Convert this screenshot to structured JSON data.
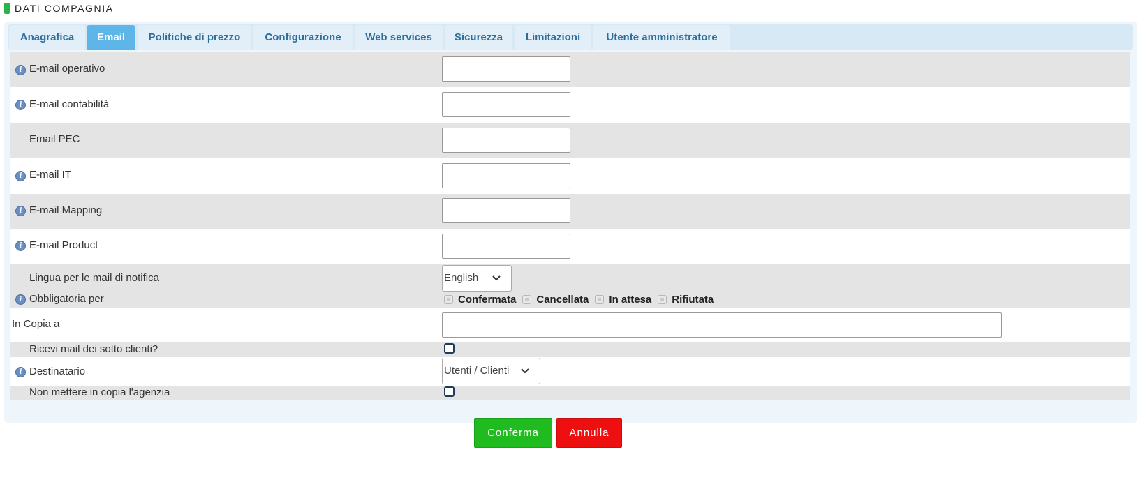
{
  "page": {
    "title": "DATI COMPAGNIA"
  },
  "tabs": [
    {
      "label": "Anagrafica",
      "active": false
    },
    {
      "label": "Email",
      "active": true
    },
    {
      "label": "Politiche di prezzo",
      "active": false
    },
    {
      "label": "Configurazione",
      "active": false
    },
    {
      "label": "Web services",
      "active": false
    },
    {
      "label": "Sicurezza",
      "active": false
    },
    {
      "label": "Limitazioni",
      "active": false
    },
    {
      "label": "Utente amministratore",
      "active": false
    }
  ],
  "form": {
    "email_operativo": {
      "label": "E-mail operativo",
      "value": "",
      "has_info": true
    },
    "email_contabilita": {
      "label": "E-mail contabilità",
      "value": "",
      "has_info": true
    },
    "email_pec": {
      "label": "Email PEC",
      "value": "",
      "has_info": false
    },
    "email_it": {
      "label": "E-mail IT",
      "value": "",
      "has_info": true
    },
    "email_mapping": {
      "label": "E-mail Mapping",
      "value": "",
      "has_info": true
    },
    "email_product": {
      "label": "E-mail Product",
      "value": "",
      "has_info": true
    },
    "lingua": {
      "label": "Lingua per le mail di notifica",
      "selected": "English"
    },
    "obbligatoria": {
      "label": "Obbligatoria per",
      "options": [
        "Confermata",
        "Cancellata",
        "In attesa",
        "Rifiutata"
      ]
    },
    "in_copia": {
      "label": "In Copia a",
      "value": ""
    },
    "ricevi_sotto_clienti": {
      "label": "Ricevi mail dei sotto clienti?",
      "checked": false
    },
    "destinatario": {
      "label": "Destinatario",
      "selected": "Utenti / Clienti"
    },
    "non_copia_agenzia": {
      "label": "Non mettere in copia l'agenzia",
      "checked": false
    }
  },
  "actions": {
    "confirm_label": "Conferma",
    "cancel_label": "Annulla"
  },
  "colors": {
    "tab_active": "#5db5e8",
    "tab_text": "#2c6f9b",
    "confirm": "#1fbb1f",
    "cancel": "#ee1010",
    "title_marker": "#2db24a"
  },
  "icons": {
    "info": "info-icon",
    "chevron": "chevron-down-icon"
  }
}
